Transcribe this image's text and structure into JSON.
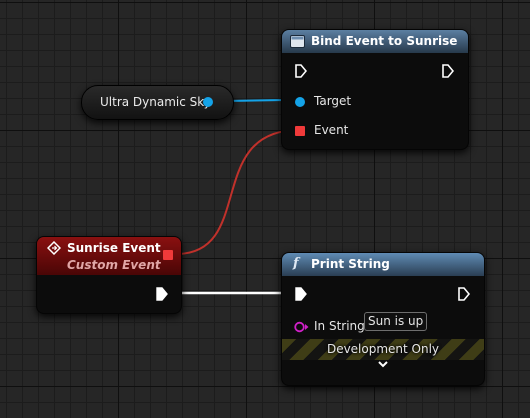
{
  "bind_node": {
    "title": "Bind Event to Sunrise",
    "header_color": "#5b7fa2",
    "icon": "function-node-icon",
    "pins": {
      "target": "Target",
      "event": "Event"
    }
  },
  "variable_node": {
    "title": "Ultra Dynamic Sky",
    "pin_color": "#14a3e8"
  },
  "custom_event_node": {
    "title": "Sunrise Event",
    "subtitle": "Custom Event",
    "header_color": "#8a1010",
    "icon": "event-diamond-icon",
    "delegate_color": "#f03a3a"
  },
  "print_node": {
    "title": "Print String",
    "icon_glyph": "f",
    "header_color": "#5f8bb4",
    "in_string_label": "In String",
    "in_string_value": "Sun is up",
    "string_pin_color": "#d020c8",
    "dev_only_label": "Development Only",
    "expand_icon": "chevron-down-icon"
  },
  "wire_colors": {
    "exec": "#ffffff",
    "object": "#14a3e8",
    "delegate": "#c0312b"
  }
}
